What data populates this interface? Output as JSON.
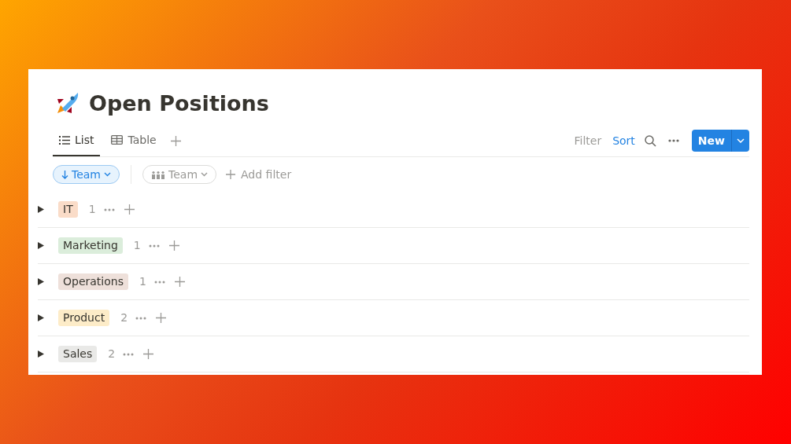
{
  "page": {
    "title": "Open Positions"
  },
  "views": [
    {
      "label": "List",
      "kind": "list",
      "selected": true
    },
    {
      "label": "Table",
      "kind": "table",
      "selected": false
    }
  ],
  "toolbar": [
    {
      "label": "Filter",
      "active": false
    },
    {
      "label": "Sort",
      "active": true
    }
  ],
  "new_button": {
    "label": "New"
  },
  "filters": [
    {
      "label": "Team",
      "kind": "sort",
      "active": true
    },
    {
      "label": "Team",
      "kind": "group",
      "active": false
    }
  ],
  "add_filter": {
    "label": "Add filter"
  },
  "groups": [
    {
      "name": "IT",
      "count": "1",
      "color": "#fadcc8",
      "expanded": false
    },
    {
      "name": "Marketing",
      "count": "1",
      "color": "#dbeddb",
      "expanded": false
    },
    {
      "name": "Operations",
      "count": "1",
      "color": "#eee0da",
      "expanded": false
    },
    {
      "name": "Product",
      "count": "2",
      "color": "#fdecc8",
      "expanded": false
    },
    {
      "name": "Sales",
      "count": "2",
      "color": "#e9e9e7",
      "expanded": false
    }
  ]
}
